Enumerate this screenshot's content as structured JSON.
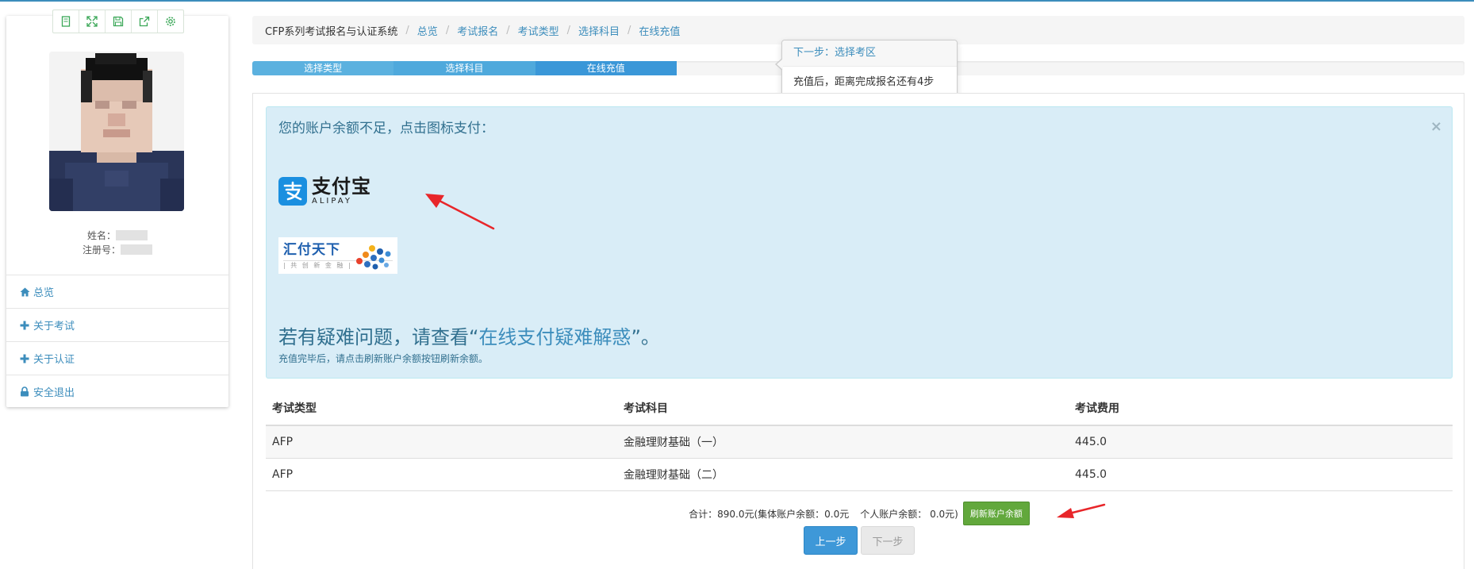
{
  "profile": {
    "toolbar_icons": [
      "page-icon",
      "fullscreen-icon",
      "save-icon",
      "share-icon",
      "settings-icon"
    ],
    "name_label": "姓名：",
    "reg_label": "注册号：",
    "nav": [
      {
        "label": "总览",
        "icon": "home-icon"
      },
      {
        "label": " 关于考试",
        "icon": "plus-icon"
      },
      {
        "label": " 关于认证",
        "icon": "plus-icon"
      },
      {
        "label": "安全退出",
        "icon": "lock-icon"
      }
    ]
  },
  "breadcrumb": [
    "CFP系列考试报名与认证系统",
    "总览",
    "考试报名",
    "考试类型",
    "选择科目",
    "在线充值"
  ],
  "steps": [
    {
      "label": "选择类型",
      "fraction": 0.1167
    },
    {
      "label": "选择科目",
      "fraction": 0.1167
    },
    {
      "label": "在线充值",
      "fraction": 0.1167
    }
  ],
  "popover": {
    "title": "下一步：选择考区",
    "body": "充值后，距离完成报名还有4步"
  },
  "alert": {
    "title": "您的账户余额不足，点击图标支付：",
    "close": "×",
    "alipay_cn": "支付宝",
    "alipay_en": "ALIPAY",
    "hftx_name": "汇付天下",
    "hftx_slogan": "| 共 创 新 金 融 |",
    "help_prefix": "若有疑难问题，请查看“",
    "help_link": "在线支付疑难解惑",
    "help_suffix": "”。",
    "note": "充值完毕后，请点击刷新账户余额按钮刷新余额。"
  },
  "table": {
    "headers": [
      "考试类型",
      "考试科目",
      "考试费用"
    ],
    "rows": [
      [
        "AFP",
        "金融理财基础（一）",
        "445.0"
      ],
      [
        "AFP",
        "金融理财基础（二）",
        "445.0"
      ]
    ]
  },
  "summary": {
    "total": "合计：890.0元(集体账户余额：0.0元",
    "personal": "个人账户余额： 0.0元)",
    "refresh": "刷新账户余额"
  },
  "buttons": {
    "prev": "上一步",
    "next": "下一步"
  },
  "colors": {
    "accent": "#3c8dbc",
    "alert_bg": "#d9edf7",
    "refresh_green": "#62a83c",
    "arrow_red": "#e8262a"
  }
}
